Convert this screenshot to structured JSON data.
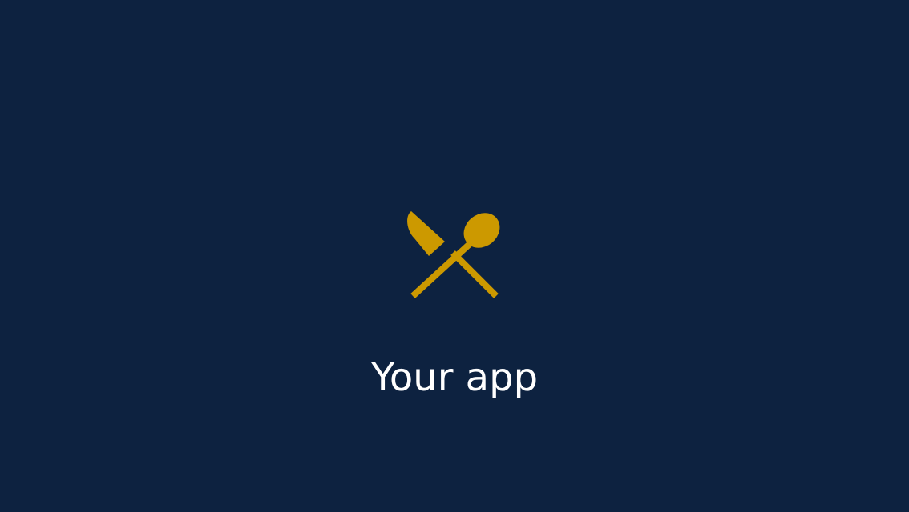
{
  "splash": {
    "app_name": "Your app",
    "logo_icon": "fork-knife-crossed-icon",
    "background_color": "#0d2240",
    "accent_color": "#cc9900",
    "text_color": "#ffffff"
  }
}
